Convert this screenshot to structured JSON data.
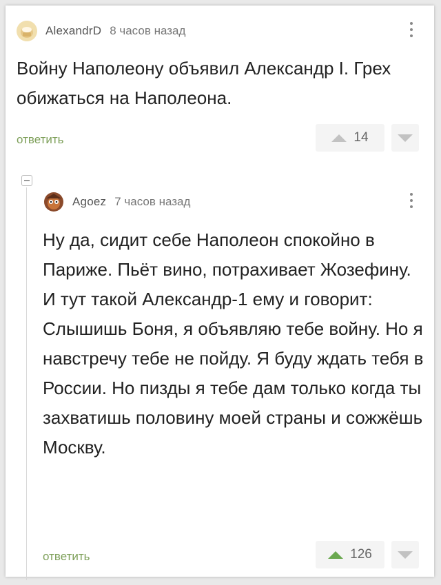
{
  "comment1": {
    "author": "AlexandrD",
    "time": "8 часов назад",
    "text": "Войну Наполеону объявил Александр I. Грех обижаться на Наполеона.",
    "reply_label": "ответить",
    "score": "14"
  },
  "comment2": {
    "author": "Agoez",
    "time": "7 часов назад",
    "text": "Ну да, сидит себе Наполеон спокойно в Париже. Пьёт вино, потрахивает Жозефину. И тут такой Александр-1 ему и говорит: Слышишь Боня, я объявляю тебе войну. Но я навстречу тебе не пойду. Я буду ждать тебя в России. Но пизды я тебе дам только когда ты захватишь половину моей страны  и сожжёшь Москву.",
    "reply_label": "ответить",
    "score": "126"
  },
  "colors": {
    "accent_green": "#6aa84f",
    "reply_green": "#7ea05a",
    "text": "#222222"
  },
  "icons": [
    "avatar-icon",
    "more-options-icon",
    "upvote-icon",
    "downvote-icon",
    "collapse-thread-icon"
  ]
}
